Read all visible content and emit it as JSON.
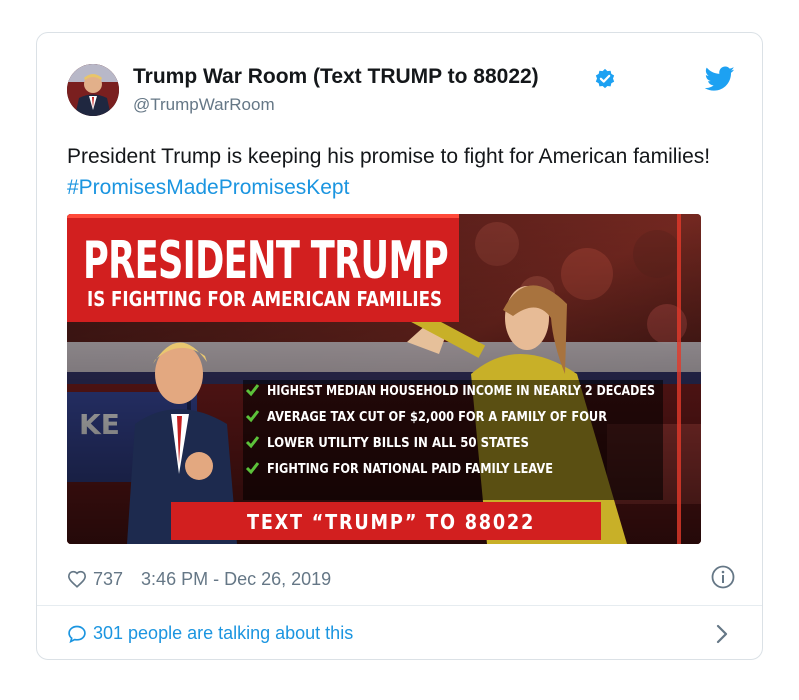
{
  "tweet": {
    "display_name": "Trump War Room (Text TRUMP to 88022)",
    "handle": "@TrumpWarRoom",
    "text": "President Trump is keeping his promise to fight for American families! ",
    "hashtag": "#PromisesMadePromisesKept",
    "likes": "737",
    "timestamp": "3:46 PM - Dec 26, 2019",
    "talking": "301 people are talking about this"
  },
  "media": {
    "headline": "PRESIDENT TRUMP",
    "subheadline": "IS FIGHTING FOR AMERICAN FAMILIES",
    "checklist": [
      "HIGHEST MEDIAN HOUSEHOLD INCOME IN NEARLY 2 DECADES",
      "AVERAGE TAX CUT OF $2,000 FOR A FAMILY OF FOUR",
      "LOWER UTILITY BILLS IN ALL 50 STATES",
      "FIGHTING FOR NATIONAL PAID FAMILY LEAVE"
    ],
    "cta": "TEXT “TRUMP” TO 88022",
    "sign_fragment": "KE"
  },
  "colors": {
    "brand_blue": "#1da1f2",
    "link_blue": "#1b95e0",
    "banner_red": "#d21f1f",
    "check_green": "#5cc23a"
  },
  "icons": [
    "verified-badge-icon",
    "twitter-bird-icon",
    "heart-icon",
    "info-icon",
    "speech-bubble-icon",
    "chevron-right-icon",
    "checkmark-icon"
  ]
}
